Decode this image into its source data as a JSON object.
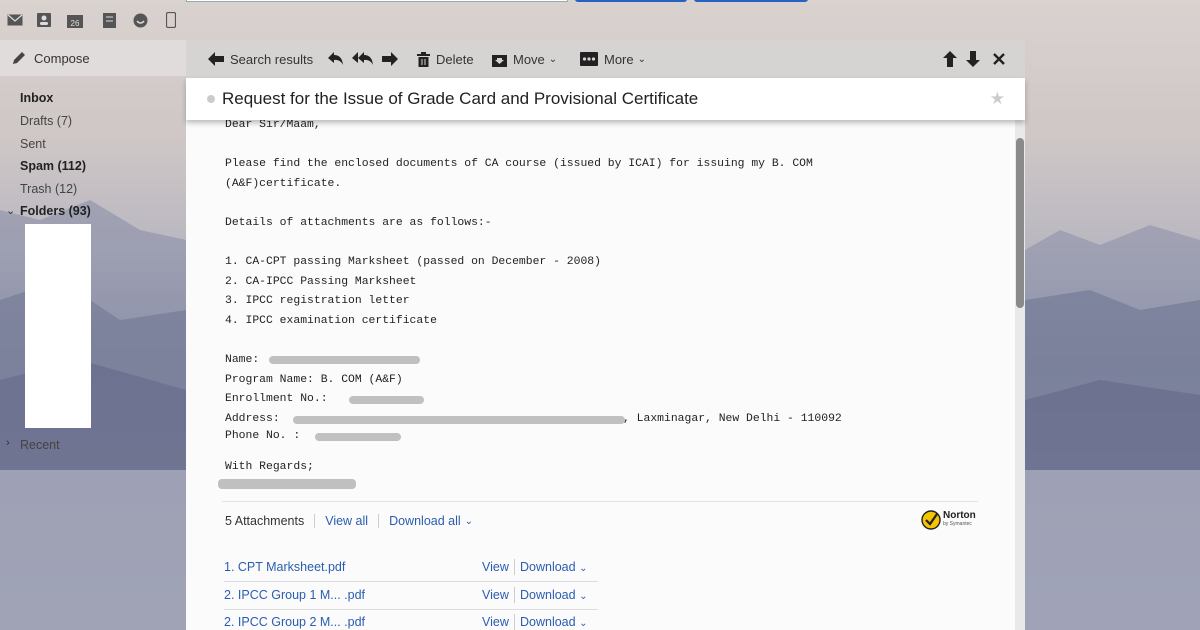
{
  "sidebar": {
    "compose_label": "Compose",
    "items": [
      {
        "label": "Inbox",
        "bold": true
      },
      {
        "label": "Drafts (7)",
        "bold": false
      },
      {
        "label": "Sent",
        "bold": false
      },
      {
        "label": "Spam (112)",
        "bold": true
      },
      {
        "label": "Trash (12)",
        "bold": false
      },
      {
        "label": "Folders (93)",
        "bold": true
      }
    ],
    "recent_label": "Recent"
  },
  "toolbar": {
    "back_label": "Search results",
    "delete_label": "Delete",
    "move_label": "Move",
    "more_label": "More"
  },
  "message": {
    "subject": "Request for the Issue of Grade Card and Provisional Certificate",
    "star": "★",
    "body_lines": [
      "Dear Sir/Maam,",
      "Please find the enclosed documents of CA course (issued by ICAI) for issuing my B. COM",
      "(A&F)certificate.",
      "Details of attachments are as follows:-",
      "1. CA-CPT passing Marksheet (passed on December - 2008)",
      "2. CA-IPCC Passing Marksheet",
      "3. IPCC registration letter",
      "4. IPCC examination certificate",
      "Name:",
      "Program Name: B. COM (A&F)",
      "Enrollment No.:",
      "Address:",
      ", Laxminagar, New Delhi - 110092",
      "Phone No. :",
      "With Regards;"
    ]
  },
  "attachments": {
    "count_label": "5 Attachments",
    "view_all": "View all",
    "download_all": "Download all",
    "norton_label": "Norton",
    "norton_sub": "by Symantec",
    "view_label": "View",
    "download_label": "Download",
    "items": [
      "1. CPT Marksheet.pdf",
      "2. IPCC Group 1 M... .pdf",
      "2. IPCC Group 2 M... .pdf"
    ]
  }
}
